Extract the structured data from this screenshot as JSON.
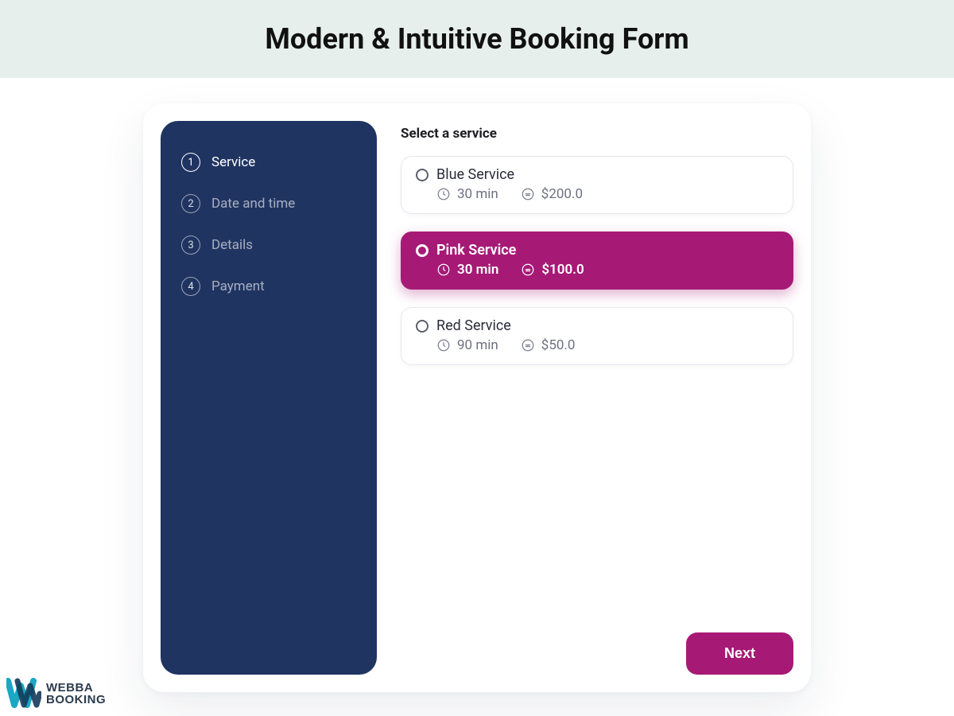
{
  "hero": {
    "title": "Modern & Intuitive Booking Form"
  },
  "sidebar": {
    "steps": [
      {
        "num": "1",
        "label": "Service",
        "active": true
      },
      {
        "num": "2",
        "label": "Date and time",
        "active": false
      },
      {
        "num": "3",
        "label": "Details",
        "active": false
      },
      {
        "num": "4",
        "label": "Payment",
        "active": false
      }
    ]
  },
  "main": {
    "title": "Select a service",
    "services": [
      {
        "name": "Blue Service",
        "duration": "30 min",
        "price": "$200.0",
        "selected": false
      },
      {
        "name": "Pink Service",
        "duration": "30 min",
        "price": "$100.0",
        "selected": true
      },
      {
        "name": "Red Service",
        "duration": "90 min",
        "price": "$50.0",
        "selected": false
      }
    ],
    "next_label": "Next"
  },
  "brand": {
    "line1": "WEBBA",
    "line2": "BOOKING"
  }
}
